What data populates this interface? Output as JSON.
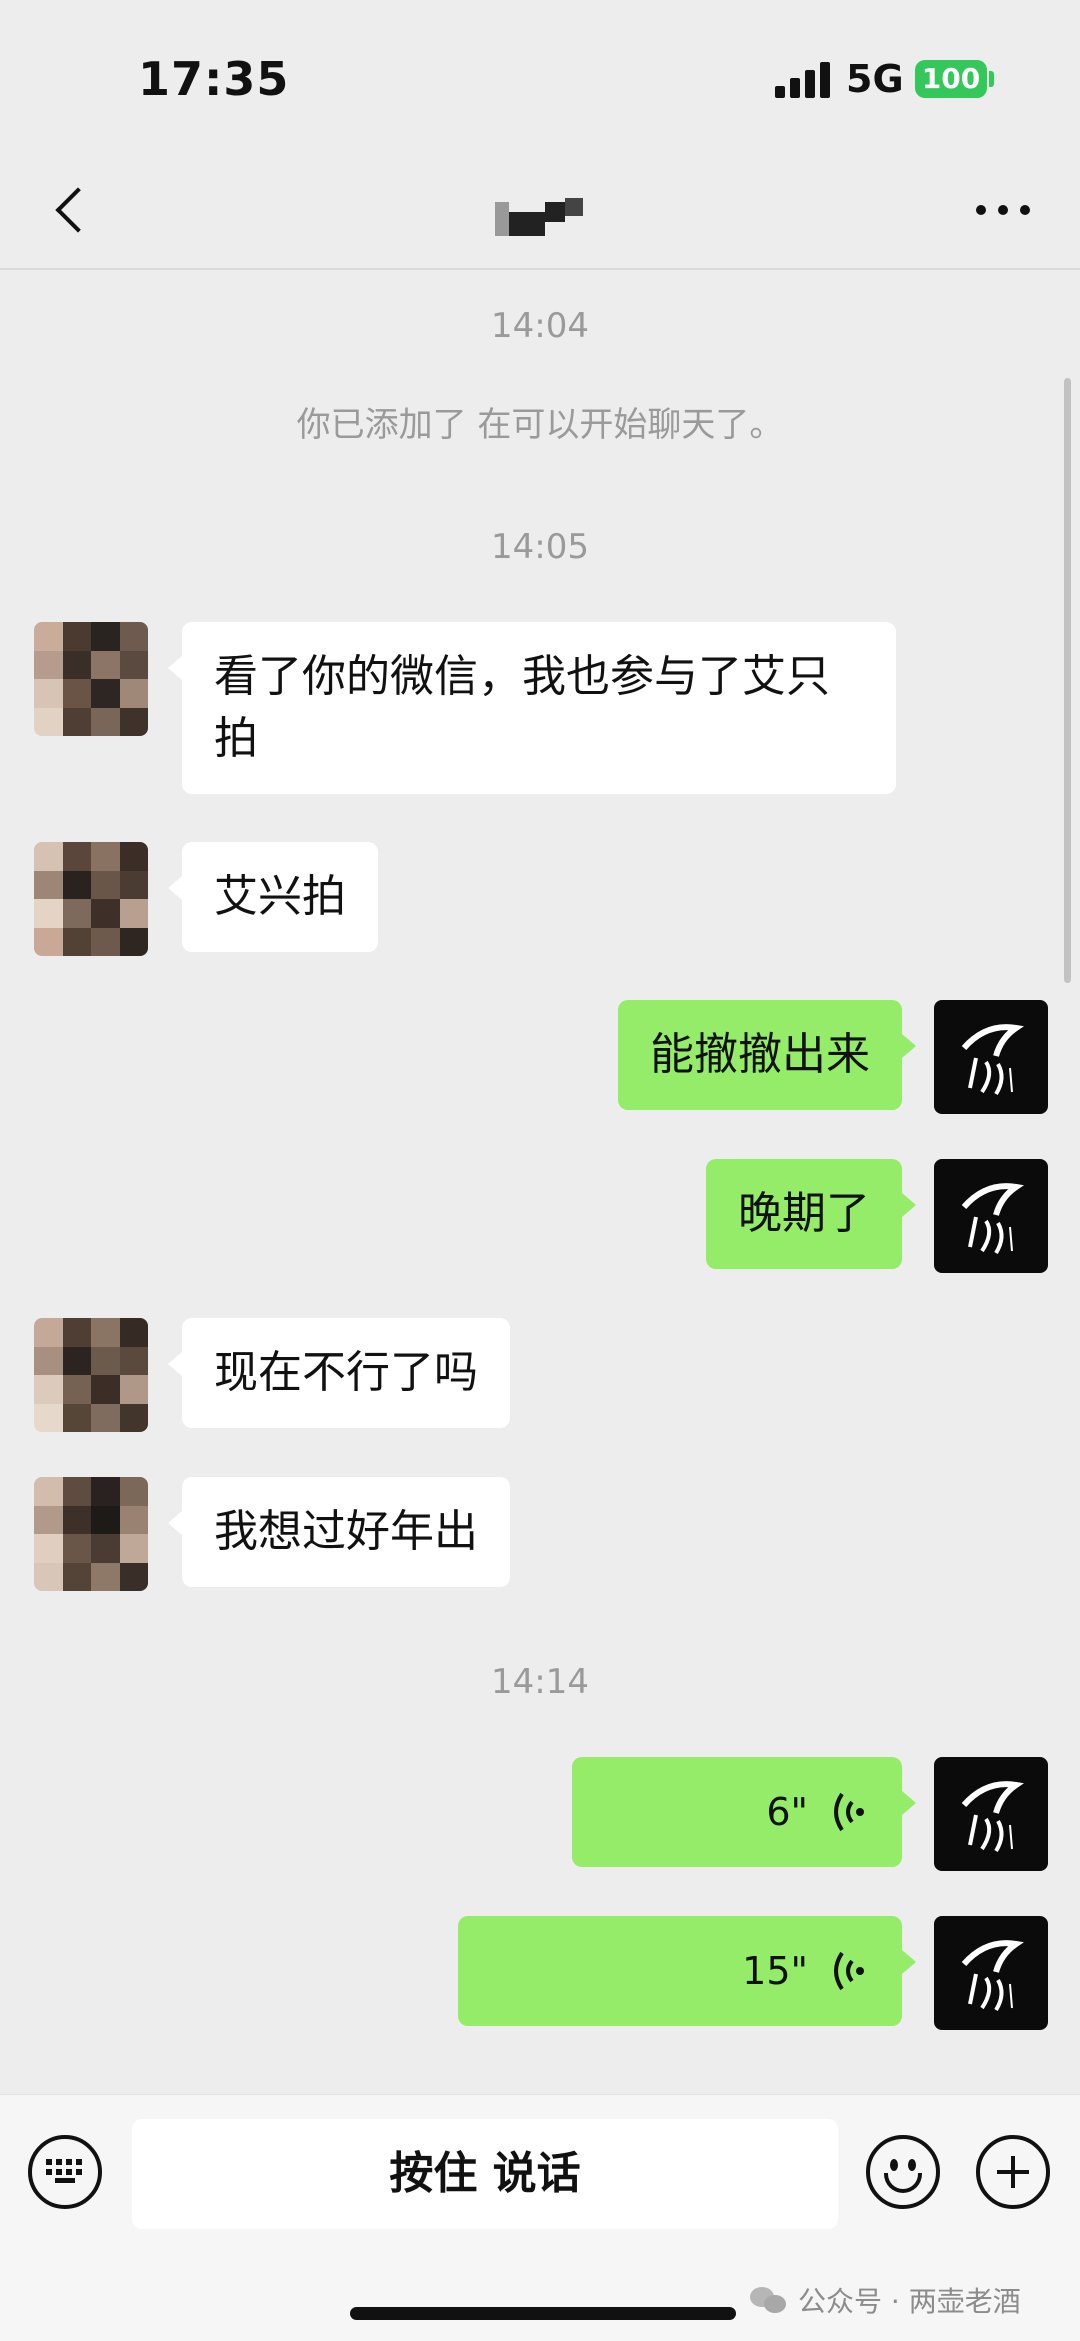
{
  "status_bar": {
    "time": "17:35",
    "network": "5G",
    "battery": "100"
  },
  "nav": {
    "title": "",
    "back_icon": "chevron-left-icon",
    "more_icon": "more-dots-icon"
  },
  "chat": {
    "timestamps": [
      "14:04",
      "14:05",
      "14:14"
    ],
    "system_message": "你已添加了                                             在可以开始聊天了。",
    "messages": [
      {
        "side": "in",
        "type": "text",
        "text": "看了你的微信，我也参与了艾只拍"
      },
      {
        "side": "in",
        "type": "text",
        "text": "艾兴拍"
      },
      {
        "side": "out",
        "type": "text",
        "text": "能撤撤出来"
      },
      {
        "side": "out",
        "type": "text",
        "text": "晚期了"
      },
      {
        "side": "in",
        "type": "text",
        "text": "现在不行了吗"
      },
      {
        "side": "in",
        "type": "text",
        "text": "我想过好年出"
      },
      {
        "side": "out",
        "type": "voice",
        "duration": "6\""
      },
      {
        "side": "out",
        "type": "voice",
        "duration": "15\""
      }
    ]
  },
  "input_bar": {
    "keyboard_icon": "keyboard-icon",
    "talk_label": "按住 说话",
    "emoji_icon": "emoji-icon",
    "plus_icon": "plus-icon"
  },
  "watermark": {
    "text": "公众号 · 两壶老酒",
    "icon": "wechat-icon"
  },
  "colors": {
    "background": "#ededed",
    "outgoing_bubble": "#95ec69",
    "incoming_bubble": "#ffffff",
    "battery": "#34c759"
  }
}
